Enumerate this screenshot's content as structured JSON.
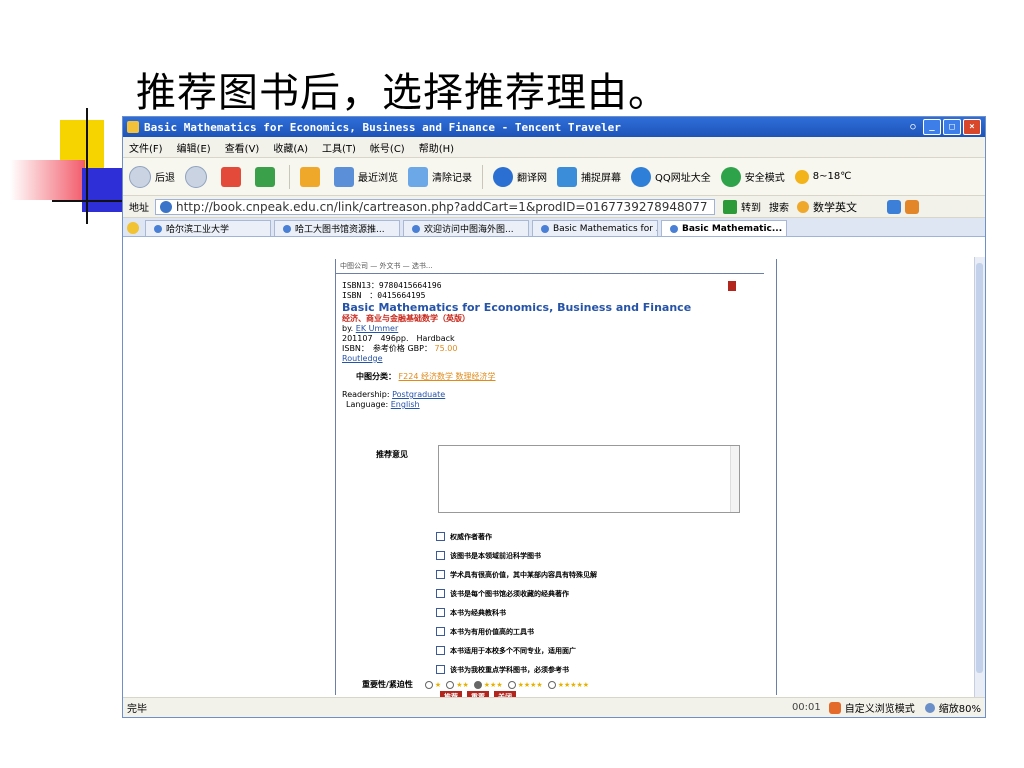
{
  "slide": {
    "heading": "推荐图书后，选择推荐理由。"
  },
  "window": {
    "title": "Basic Mathematics for Economics, Business and Finance - Tencent Traveler"
  },
  "menu": [
    "文件(F)",
    "编辑(E)",
    "查看(V)",
    "收藏(A)",
    "工具(T)",
    "帐号(C)",
    "帮助(H)"
  ],
  "toolbar": {
    "back": "后退",
    "recent": "最近浏览",
    "clear": "清除记录",
    "translate": "翻译网",
    "capture": "捕捉屏幕",
    "qq_sites": "QQ网址大全",
    "safe_mode": "安全模式",
    "weather": "8~18℃"
  },
  "address": {
    "label": "地址",
    "url": "http://book.cnpeak.edu.cn/link/cartreason.php?addCart=1&prodID=0167739278948077",
    "go": "转到",
    "search_label": "搜索",
    "search_value": "数学英文"
  },
  "tabs": [
    {
      "label": "哈尔滨工业大学"
    },
    {
      "label": "哈工大图书馆资源推..."
    },
    {
      "label": "欢迎访问中图海外图..."
    },
    {
      "label": "Basic Mathematics for ..."
    },
    {
      "label": "Basic Mathematic... ×"
    }
  ],
  "page": {
    "header": "中图公司 — 外文书 — 选书...",
    "isbn13": "ISBN13：9780415664196",
    "isbn": "ISBN　：0415664195",
    "book_title": "Basic Mathematics for Economics, Business and Finance",
    "book_title_cn": "经济、商业与金融基础数学（英版）",
    "by_prefix": "by.",
    "author": "EK Ummer",
    "pub": "201107　496pp.　Hardback",
    "isbn_price_label": "ISBN：　参考价格 GBP：",
    "price": "75.00",
    "publisher": "Routledge",
    "category_label": "中图分类：",
    "category": "F224 经济数学  数理经济学",
    "readership_label": "Readership:",
    "readership": "Postgraduate",
    "language_label": "Language:",
    "language": "English",
    "reason_label": "推荐意见",
    "reasons": [
      "权威作者著作",
      "该图书是本领域前沿科学图书",
      "学术具有很高价值，其中某部内容具有特殊见解",
      "该书是每个图书馆必须收藏的经典著作",
      "本书为经典教科书",
      "本书为有用价值高的工具书",
      "本书适用于本校多个不同专业，适用面广",
      "该书为我校重点学科图书，必须参考书"
    ],
    "rating_label": "重要性/紧迫性",
    "stars": [
      "★",
      "★★",
      "★★★",
      "★★★★",
      "★★★★★"
    ],
    "buttons": [
      "推荐",
      "重置",
      "关闭"
    ]
  },
  "status": {
    "left": "完毕",
    "time": "00:01",
    "mode": "自定义浏览模式",
    "zoom": "缩放80%"
  }
}
